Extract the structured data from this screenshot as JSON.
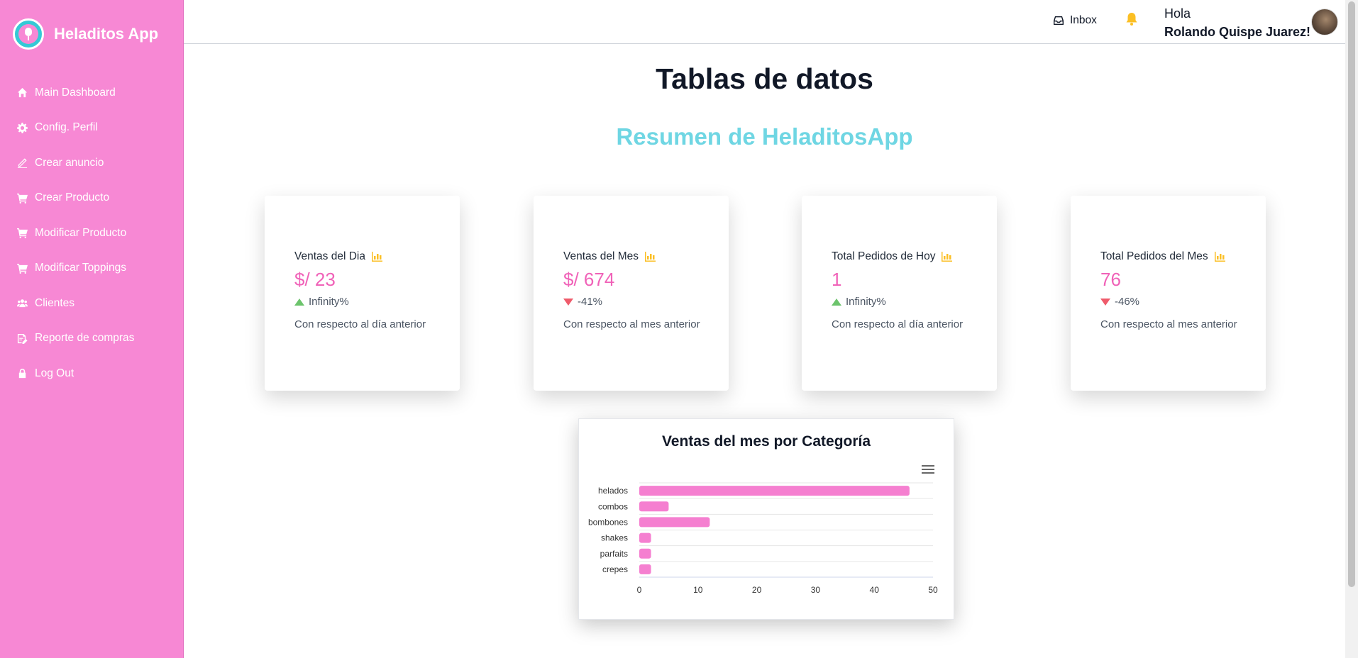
{
  "sidebar": {
    "brand": "Heladitos App",
    "items": [
      {
        "label": "Main Dashboard",
        "icon": "home-icon"
      },
      {
        "label": "Config. Perfil",
        "icon": "gear-icon"
      },
      {
        "label": "Crear anuncio",
        "icon": "pencil-icon"
      },
      {
        "label": "Crear Producto",
        "icon": "cart-icon"
      },
      {
        "label": "Modificar Producto",
        "icon": "cart-icon"
      },
      {
        "label": "Modificar Toppings",
        "icon": "cart-icon"
      },
      {
        "label": "Clientes",
        "icon": "users-icon"
      },
      {
        "label": "Reporte de compras",
        "icon": "report-icon"
      },
      {
        "label": "Log Out",
        "icon": "lock-icon"
      }
    ]
  },
  "header": {
    "inbox_label": "Inbox",
    "greeting": "Hola",
    "user_name": "Rolando Quispe Juarez!"
  },
  "main": {
    "title": "Tablas de datos",
    "subtitle": "Resumen de HeladitosApp"
  },
  "cards": [
    {
      "title": "Ventas del Dia",
      "value": "$/ 23",
      "change": "Infinity%",
      "trend": "up",
      "note": "Con respecto al día anterior"
    },
    {
      "title": "Ventas del Mes",
      "value": "$/ 674",
      "change": "-41%",
      "trend": "down",
      "note": "Con respecto al mes anterior"
    },
    {
      "title": "Total Pedidos de Hoy",
      "value": "1",
      "change": "Infinity%",
      "trend": "up",
      "note": "Con respecto al día anterior"
    },
    {
      "title": "Total Pedidos del Mes",
      "value": "76",
      "change": "-46%",
      "trend": "down",
      "note": "Con respecto al mes anterior"
    }
  ],
  "colors": {
    "sidebar": "#f788d4",
    "accent_pink": "#f062b8",
    "subtitle_cyan": "#6fd6e3",
    "icon_yellow": "#fbbf24",
    "trend_up": "#6cc46c",
    "trend_down": "#ef5b6b",
    "bar": "#f57fd0"
  },
  "chart_data": {
    "type": "bar",
    "orientation": "horizontal",
    "title": "Ventas del mes por Categoría",
    "categories": [
      "helados",
      "combos",
      "bombones",
      "shakes",
      "parfaits",
      "crepes"
    ],
    "values": [
      46,
      5,
      12,
      2,
      2,
      2
    ],
    "xlim": [
      0,
      50
    ],
    "xticks": [
      0,
      10,
      20,
      30,
      40,
      50
    ],
    "grid": true
  }
}
